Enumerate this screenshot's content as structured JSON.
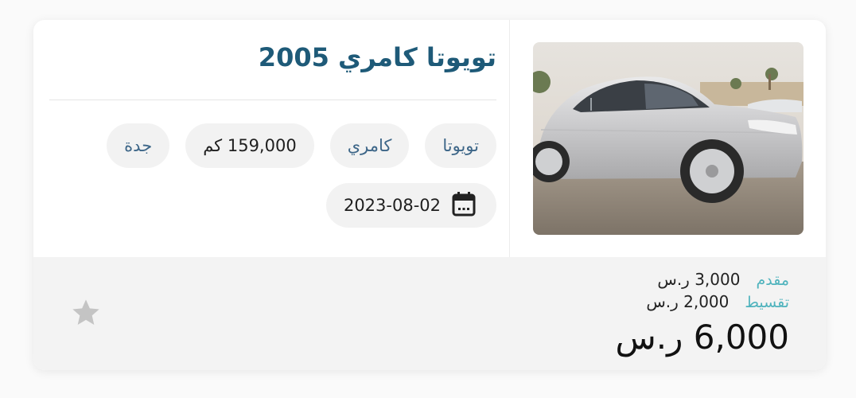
{
  "listing": {
    "title": "تويوتا كامري 2005",
    "chips": {
      "make": "تويوتا",
      "model": "كامري",
      "mileage": "159,000 كم",
      "city": "جدة"
    },
    "date": "2023-08-02",
    "icons": {
      "date": "calendar-icon",
      "favorite": "star-icon"
    },
    "colors": {
      "title": "#1e5a78",
      "chip_text": "#3d6688",
      "price_label": "#4fb3bd",
      "star": "#c4c4c4"
    }
  },
  "pricing": {
    "down_payment_label": "مقدم",
    "down_payment_value": "3,000 ر.س",
    "installment_label": "تقسيط",
    "installment_value": "2,000 ر.س",
    "total": "6,000 ر.س"
  }
}
